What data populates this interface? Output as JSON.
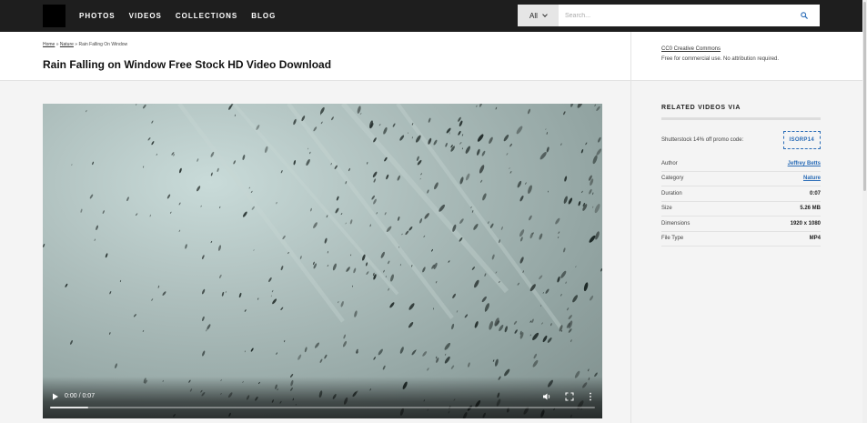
{
  "nav": {
    "links": [
      "PHOTOS",
      "VIDEOS",
      "COLLECTIONS",
      "BLOG"
    ],
    "search": {
      "category": "All",
      "placeholder": "Search..."
    }
  },
  "breadcrumb": {
    "home": "Home",
    "sep1": " » ",
    "category": "Nature",
    "sep2": " » ",
    "current": "Rain Falling On Window"
  },
  "page_title": "Rain Falling on Window Free Stock HD Video Download",
  "license": {
    "link": "CC0 Creative Commons",
    "text": "Free for commercial use. No attribution required."
  },
  "sidebar": {
    "related_title": "RELATED VIDEOS VIA",
    "promo": {
      "label": "Shutterstock 14% off promo code:",
      "code": "ISORP14"
    },
    "meta": [
      {
        "label": "Author",
        "value": "Jeffrey Betts"
      },
      {
        "label": "Category",
        "value": "Nature"
      },
      {
        "label": "Duration",
        "value": "0:07"
      },
      {
        "label": "Size",
        "value": "5.26 MB"
      },
      {
        "label": "Dimensions",
        "value": "1920 x 1080"
      },
      {
        "label": "File Type",
        "value": "MP4"
      }
    ]
  },
  "video": {
    "time": "0:00 / 0:07",
    "progress": 0.07
  },
  "colors": {
    "nav_bg": "#1e1e1e",
    "link_blue": "#2a6cb7",
    "page_bg": "#f4f4f4"
  },
  "icons": [
    "search-icon",
    "chevron-down-icon",
    "play-icon",
    "volume-icon",
    "fullscreen-icon",
    "more-vertical-icon"
  ]
}
